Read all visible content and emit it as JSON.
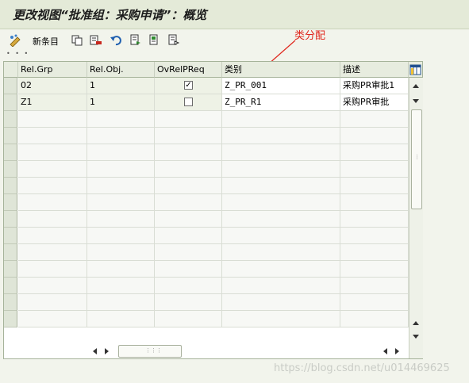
{
  "window": {
    "title": "更改视图“批准组：采购申请”：概览"
  },
  "toolbar": {
    "new_entries_label": "新条目"
  },
  "annotation": {
    "text": "类分配"
  },
  "table": {
    "columns": [
      "Rel.Grp",
      "Rel.Obj.",
      "OvRelPReq",
      "类别",
      "描述"
    ],
    "rows": [
      {
        "rel_grp": "02",
        "rel_obj": "1",
        "ovrelpreq": true,
        "class": "Z_PR_001",
        "desc": "采购PR审批1"
      },
      {
        "rel_grp": "Z1",
        "rel_obj": "1",
        "ovrelpreq": false,
        "class": "Z_PR_R1",
        "desc": "采购PR审批"
      }
    ]
  },
  "watermark": {
    "text": "https://blog.csdn.net/u014469625"
  },
  "colors": {
    "accent": "#e0261c",
    "title_bar": "#e4ead8",
    "grid_header": "#e7ecdf"
  }
}
